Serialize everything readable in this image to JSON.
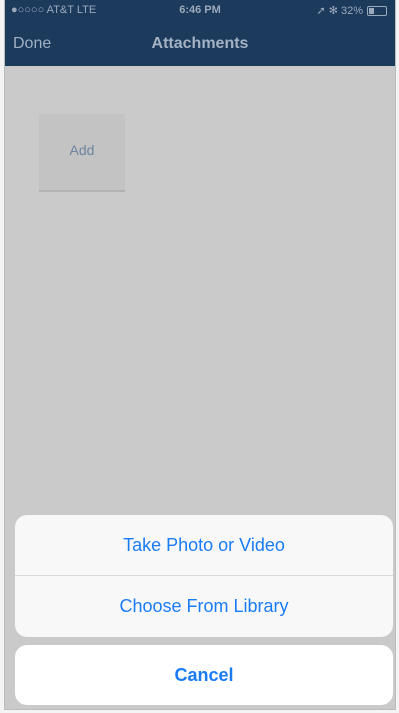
{
  "status_bar": {
    "carrier": "●○○○○ AT&T  LTE",
    "time": "6:46 PM",
    "indicators": "➚ ✻ 32%",
    "battery_percent": 32
  },
  "nav": {
    "done_label": "Done",
    "title": "Attachments"
  },
  "content": {
    "add_label": "Add"
  },
  "action_sheet": {
    "options": [
      {
        "label": "Take Photo or Video"
      },
      {
        "label": "Choose From Library"
      }
    ],
    "cancel_label": "Cancel"
  },
  "colors": {
    "nav_bg": "#1c3a5c",
    "action_blue": "#1a7cf5"
  }
}
